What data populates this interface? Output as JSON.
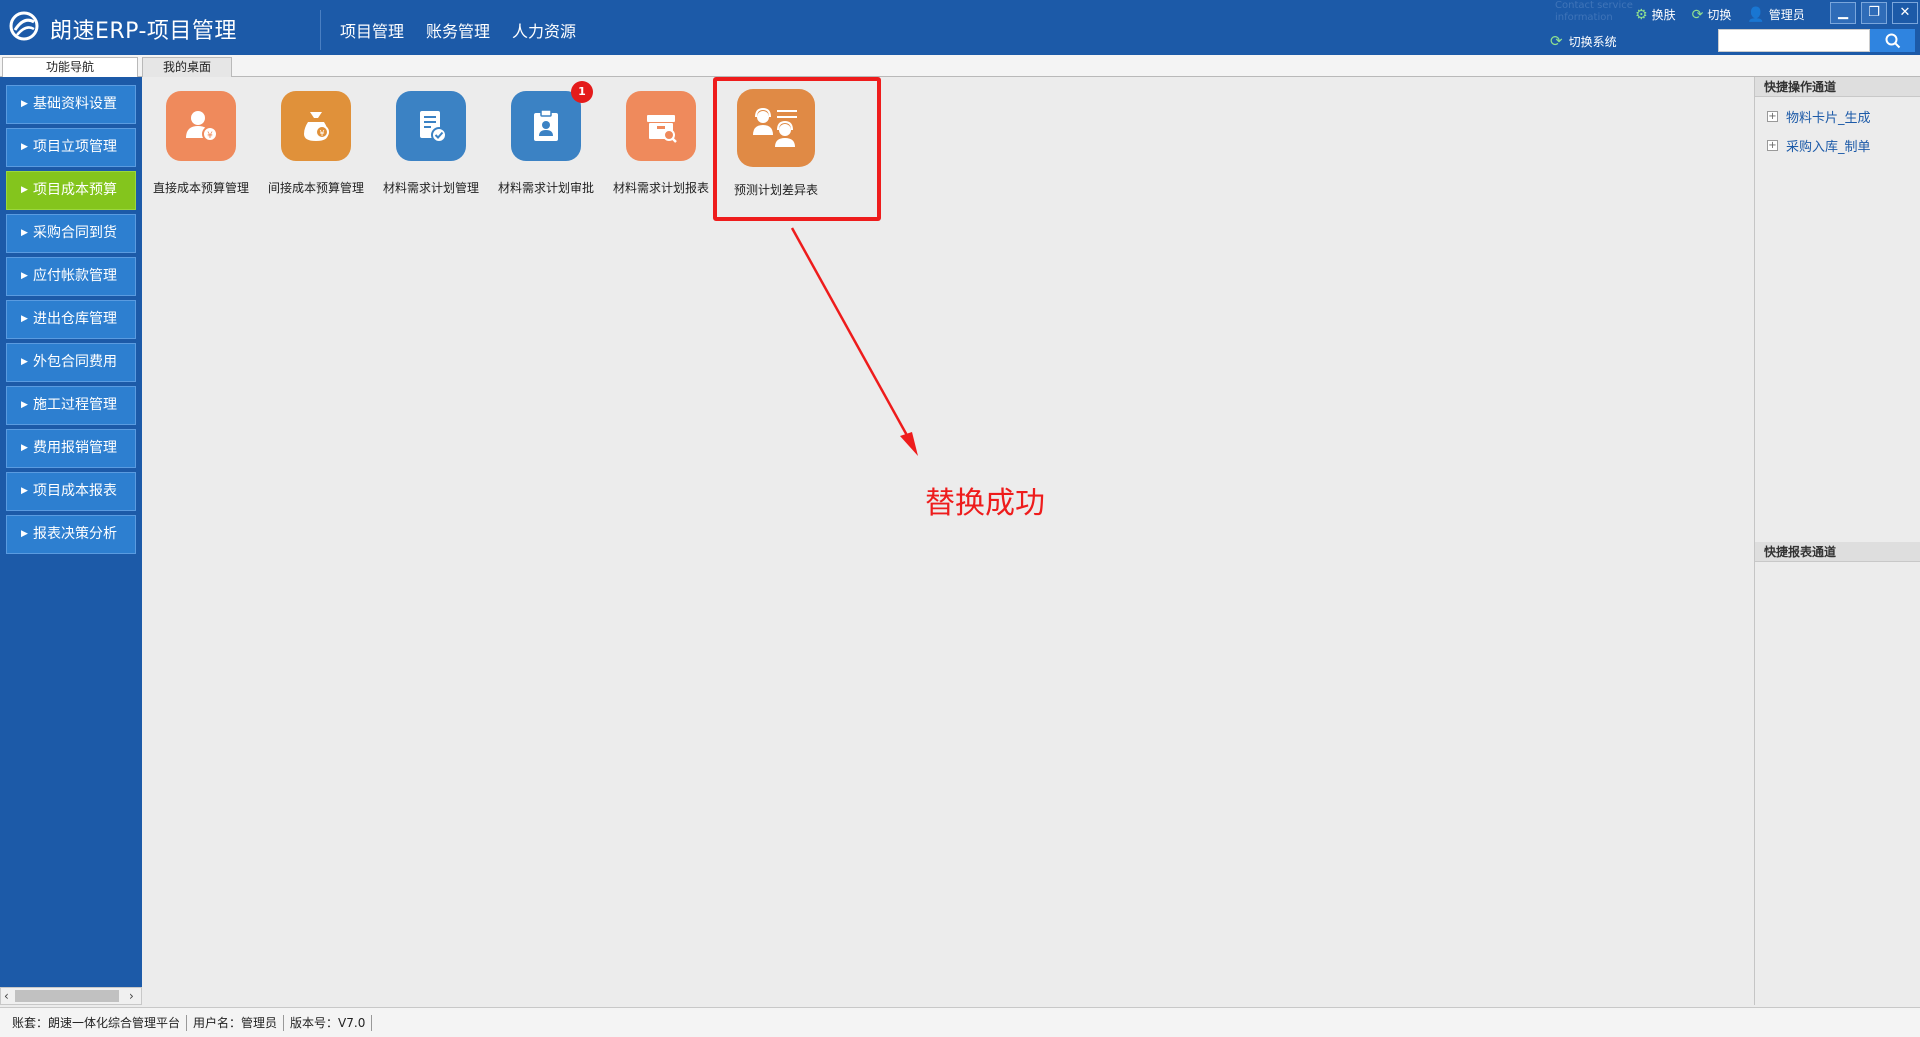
{
  "header": {
    "title": "朗速ERP-项目管理",
    "nav": [
      "项目管理",
      "账务管理",
      "人力资源"
    ],
    "faint_text": "Contact service information",
    "tools": [
      {
        "label": "换肤",
        "icon": "gear-icon"
      },
      {
        "label": "切换",
        "icon": "refresh-icon"
      },
      {
        "label": "管理员",
        "icon": "user-icon"
      }
    ],
    "switch_system": "切换系统",
    "search_placeholder": ""
  },
  "tabs": [
    {
      "label": "功能导航",
      "active": true
    },
    {
      "label": "我的桌面",
      "active": false
    }
  ],
  "sidebar": {
    "items": [
      {
        "label": "基础资料设置",
        "active": false
      },
      {
        "label": "项目立项管理",
        "active": false
      },
      {
        "label": "项目成本预算",
        "active": true
      },
      {
        "label": "采购合同到货",
        "active": false
      },
      {
        "label": "应付帐款管理",
        "active": false
      },
      {
        "label": "进出仓库管理",
        "active": false
      },
      {
        "label": "外包合同费用",
        "active": false
      },
      {
        "label": "施工过程管理",
        "active": false
      },
      {
        "label": "费用报销管理",
        "active": false
      },
      {
        "label": "项目成本报表",
        "active": false
      },
      {
        "label": "报表决策分析",
        "active": false
      }
    ]
  },
  "apps": [
    {
      "label": "直接成本预算管理",
      "color": "#ef8a5c",
      "icon": "person-coin-icon"
    },
    {
      "label": "间接成本预算管理",
      "color": "#e0913a",
      "icon": "money-bag-icon"
    },
    {
      "label": "材料需求计划管理",
      "color": "#3b82c4",
      "icon": "document-check-icon"
    },
    {
      "label": "材料需求计划审批",
      "color": "#3b82c4",
      "icon": "clipboard-person-icon",
      "badge": "1"
    },
    {
      "label": "材料需求计划报表",
      "color": "#ef8a5c",
      "icon": "box-search-icon"
    },
    {
      "label": "预测计划差异表",
      "color": "#e08a45",
      "icon": "support-team-icon"
    }
  ],
  "annotation": "替换成功",
  "right_panel": {
    "ops_title": "快捷操作通道",
    "ops_links": [
      "物料卡片_生成",
      "采购入库_制单"
    ],
    "reports_title": "快捷报表通道"
  },
  "status": [
    "账套：朗速一体化综合管理平台",
    "用户名：管理员",
    "版本号：V7.0"
  ],
  "colors": {
    "header": "#1c5aa8",
    "menu": "#2d7fd0",
    "menu_active": "#84c51d",
    "highlight": "#ee1c1c"
  }
}
